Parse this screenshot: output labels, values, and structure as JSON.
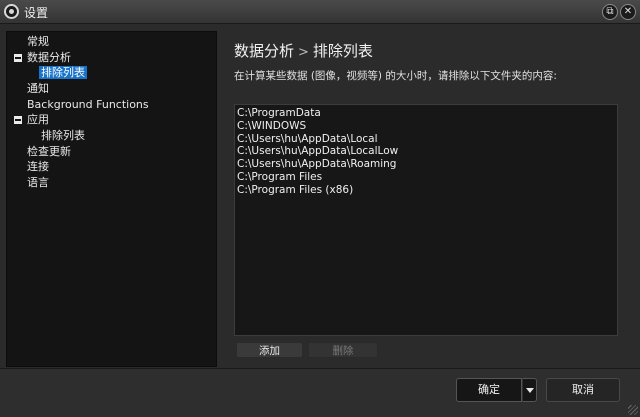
{
  "window": {
    "title": "设置"
  },
  "tree": {
    "items": [
      {
        "label": "常规",
        "selected": false
      },
      {
        "label": "数据分析",
        "expanded": true
      },
      {
        "label": "排除列表",
        "selected": true
      },
      {
        "label": "通知"
      },
      {
        "label": "Background Functions"
      },
      {
        "label": "应用",
        "expanded": true
      },
      {
        "label": "排除列表"
      },
      {
        "label": "检查更新"
      },
      {
        "label": "连接"
      },
      {
        "label": "语言"
      }
    ]
  },
  "main": {
    "breadcrumb_parent": "数据分析",
    "breadcrumb_separator": ">",
    "breadcrumb_current": "排除列表",
    "description": "在计算某些数据 (图像，视频等) 的大小时，请排除以下文件夹的内容:",
    "paths": [
      "C:\\ProgramData",
      "C:\\WINDOWS",
      "C:\\Users\\hu\\AppData\\Local",
      "C:\\Users\\hu\\AppData\\LocalLow",
      "C:\\Users\\hu\\AppData\\Roaming",
      "C:\\Program Files",
      "C:\\Program Files (x86)"
    ],
    "add_label": "添加",
    "delete_label": "删除"
  },
  "footer": {
    "ok_label": "确定",
    "cancel_label": "取消"
  },
  "colors": {
    "selection": "#1873c9",
    "background": "#2b2b2b",
    "panel": "#141414"
  }
}
